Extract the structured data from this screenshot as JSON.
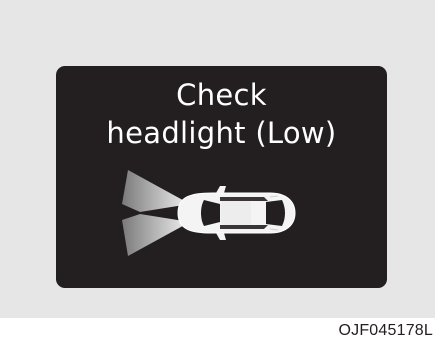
{
  "warning": {
    "line1": "Check",
    "line2": "headlight (Low)",
    "icon": "car-headlight-beam-icon"
  },
  "caption": "OJF045178L",
  "colors": {
    "display_bg": "#231f20",
    "text": "#ffffff",
    "panel_bg": "#e6e6e6",
    "beam_light": "#d0d0d0",
    "beam_dark": "#8a8a8a"
  }
}
